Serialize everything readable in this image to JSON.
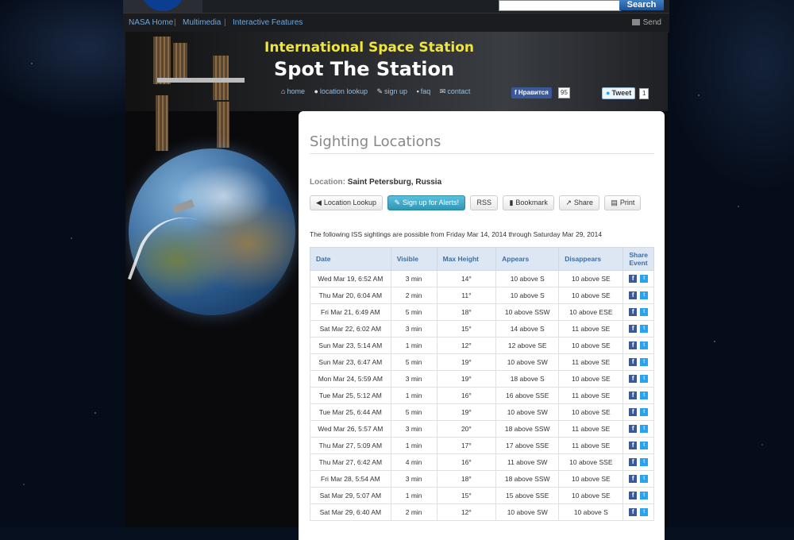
{
  "header": {
    "search_placeholder": "",
    "search_button": "Search",
    "nav": [
      "NASA Home",
      "Multimedia",
      "Interactive Features"
    ],
    "send_label": "Send"
  },
  "site": {
    "subtitle": "International Space Station",
    "title": "Spot The Station",
    "nav": [
      {
        "icon": "home-icon",
        "label": "home"
      },
      {
        "icon": "map-pin-icon",
        "label": "location lookup"
      },
      {
        "icon": "pencil-icon",
        "label": "sign up"
      },
      {
        "icon": "comment-icon",
        "label": "faq"
      },
      {
        "icon": "envelope-icon",
        "label": "contact"
      }
    ],
    "fb_like_label": "Нравится",
    "fb_like_count": "95",
    "tweet_label": "Tweet",
    "tweet_count": "1"
  },
  "content": {
    "title": "Sighting Locations",
    "location_label": "Location:",
    "location_value": "Saint Petersburg, Russia",
    "buttons": [
      {
        "icon": "arrow-left-icon",
        "label": "Location Lookup"
      },
      {
        "icon": "pencil-icon",
        "label": "Sign up for Alerts!"
      },
      {
        "icon": "",
        "label": "RSS"
      },
      {
        "icon": "bookmark-icon",
        "label": "Bookmark"
      },
      {
        "icon": "share-icon",
        "label": "Share"
      },
      {
        "icon": "print-icon",
        "label": "Print"
      }
    ],
    "intro": "The following ISS sightings are possible from Friday Mar 14, 2014 through Saturday Mar 29, 2014"
  },
  "table": {
    "headers": [
      "Date",
      "Visible",
      "Max Height",
      "Appears",
      "Disappears",
      "Share Event"
    ],
    "rows": [
      [
        "Wed Mar 19, 6:52 AM",
        "3 min",
        "14°",
        "10 above S",
        "10 above SE"
      ],
      [
        "Thu Mar 20, 6:04 AM",
        "2 min",
        "11°",
        "10 above S",
        "10 above SE"
      ],
      [
        "Fri Mar 21, 6:49 AM",
        "5 min",
        "18°",
        "10 above SSW",
        "10 above ESE"
      ],
      [
        "Sat Mar 22, 6:02 AM",
        "3 min",
        "15°",
        "14 above S",
        "11 above SE"
      ],
      [
        "Sun Mar 23, 5:14 AM",
        "1 min",
        "12°",
        "12 above SE",
        "10 above SE"
      ],
      [
        "Sun Mar 23, 6:47 AM",
        "5 min",
        "19°",
        "10 above SW",
        "11 above SE"
      ],
      [
        "Mon Mar 24, 5:59 AM",
        "3 min",
        "19°",
        "18 above S",
        "10 above SE"
      ],
      [
        "Tue Mar 25, 5:12 AM",
        "1 min",
        "16°",
        "16 above SSE",
        "11 above SE"
      ],
      [
        "Tue Mar 25, 6:44 AM",
        "5 min",
        "19°",
        "10 above SW",
        "10 above SE"
      ],
      [
        "Wed Mar 26, 5:57 AM",
        "3 min",
        "20°",
        "18 above SSW",
        "11 above SE"
      ],
      [
        "Thu Mar 27, 5:09 AM",
        "1 min",
        "17°",
        "17 above SSE",
        "11 above SE"
      ],
      [
        "Thu Mar 27, 6:42 AM",
        "4 min",
        "16°",
        "11 above SW",
        "10 above SSE"
      ],
      [
        "Fri Mar 28, 5:54 AM",
        "3 min",
        "18°",
        "18 above SSW",
        "10 above SE"
      ],
      [
        "Sat Mar 29, 5:07 AM",
        "1 min",
        "15°",
        "15 above SSE",
        "10 above SE"
      ],
      [
        "Sat Mar 29, 6:40 AM",
        "2 min",
        "12°",
        "10 above SW",
        "10 above S"
      ]
    ]
  },
  "colors": {
    "title_yellow": "#f0e63a",
    "link_blue": "#6fa8dc",
    "table_header_bg": "#dde7f3",
    "primary_button": "#2f96b4",
    "facebook": "#3b5998",
    "twitter": "#2aa3ef"
  }
}
